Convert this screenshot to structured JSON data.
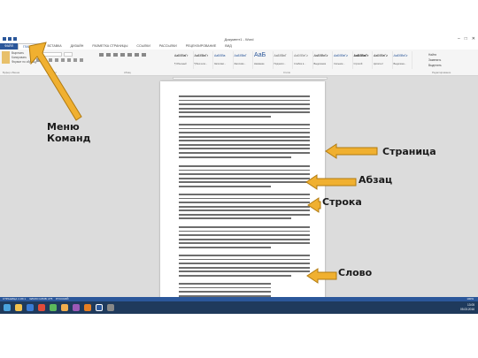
{
  "window": {
    "title": "Документ1 - Word",
    "min": "–",
    "max": "□",
    "close": "✕"
  },
  "tabs": [
    "ФАЙЛ",
    "ГЛАВНАЯ",
    "ВСТАВКА",
    "ДИЗАЙН",
    "РАЗМЕТКА СТРАНИЦЫ",
    "ССЫЛКИ",
    "РАССЫЛКИ",
    "РЕЦЕНЗИРОВАНИЕ",
    "ВИД"
  ],
  "ribbon": {
    "cut": "Вырезать",
    "copy": "Копировать",
    "format_painter": "Формат по образцу",
    "groups": [
      "Буфер обмена",
      "Шрифт",
      "Абзац",
      "Стили",
      "Редактирование"
    ],
    "styles": [
      {
        "sample": "АаБбВвГг",
        "name": "¶ Обычный"
      },
      {
        "sample": "АаБбВвГг",
        "name": "¶ Без инте..."
      },
      {
        "sample": "АаБбВв",
        "name": "Заголово..."
      },
      {
        "sample": "АаБбВвГ",
        "name": "Заголово..."
      },
      {
        "sample": "АаБ",
        "name": "Название"
      },
      {
        "sample": "АаБбВвГ",
        "name": "Подзагол..."
      },
      {
        "sample": "АаБбВвГг",
        "name": "Слабое в..."
      },
      {
        "sample": "АаБбВвГг",
        "name": "Выделение"
      },
      {
        "sample": "АаБбВвГг",
        "name": "Сильное..."
      },
      {
        "sample": "АаБбВвГг",
        "name": "Строгий"
      },
      {
        "sample": "АаБбВвГг",
        "name": "Цитата 2"
      },
      {
        "sample": "АаБбВвГг",
        "name": "Выделенн..."
      }
    ],
    "find": "Найти",
    "replace": "Заменить",
    "select": "Выделить"
  },
  "status": {
    "page": "СТРАНИЦА 1 ИЗ 1",
    "words": "ЧИСЛО СЛОВ: 275",
    "lang": "РУССКИЙ",
    "zoom": "100%"
  },
  "taskbar": {
    "time": "13:05",
    "date": "05.03.2016"
  },
  "annotations": {
    "commands_menu": "Меню Команд",
    "page": "Страница",
    "paragraph": "Абзац",
    "line": "Строка",
    "word": "Слово"
  },
  "colors": {
    "word_blue": "#2b579a",
    "arrow_fill": "#f0b030",
    "highlight": "#ffe600"
  }
}
